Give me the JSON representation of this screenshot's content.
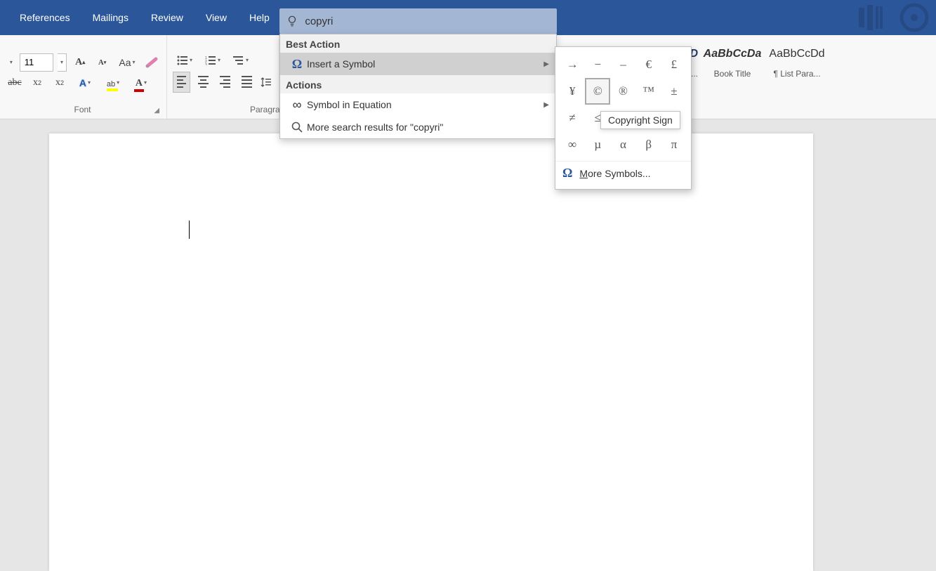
{
  "tabs": {
    "references": "References",
    "mailings": "Mailings",
    "review": "Review",
    "view": "View",
    "help": "Help"
  },
  "search": {
    "value": "copyri"
  },
  "font": {
    "size": "11",
    "group_label": "Font"
  },
  "paragraph": {
    "group_label": "Paragraph"
  },
  "styles": {
    "style1": {
      "preview": "AaBbCcDa",
      "name": "Book Title"
    },
    "style2": {
      "preview": "AaBbCcDd",
      "name": "¶ List Para..."
    },
    "partial_name": "e..."
  },
  "dropdown": {
    "best_action": "Best Action",
    "insert_symbol": "Insert a Symbol",
    "actions": "Actions",
    "symbol_equation": "Symbol in Equation",
    "more_results": "More search results for \"copyri\""
  },
  "symbols": {
    "r1c1": "→",
    "r1c2": "−",
    "r1c3": "–",
    "r1c4": "€",
    "r1c5": "£",
    "r2c1": "¥",
    "r2c2": "©",
    "r2c3": "®",
    "r2c4": "™",
    "r2c5": "±",
    "r3c1": "≠",
    "r3c2": "≤",
    "r3c3": "",
    "r3c4": "",
    "r3c5": "",
    "r4c1": "∞",
    "r4c2": "µ",
    "r4c3": "α",
    "r4c4": "β",
    "r4c5": "π",
    "more_m": "M",
    "more_rest": "ore Symbols..."
  },
  "tooltip": "Copyright Sign",
  "partial_style_preview": "DD"
}
